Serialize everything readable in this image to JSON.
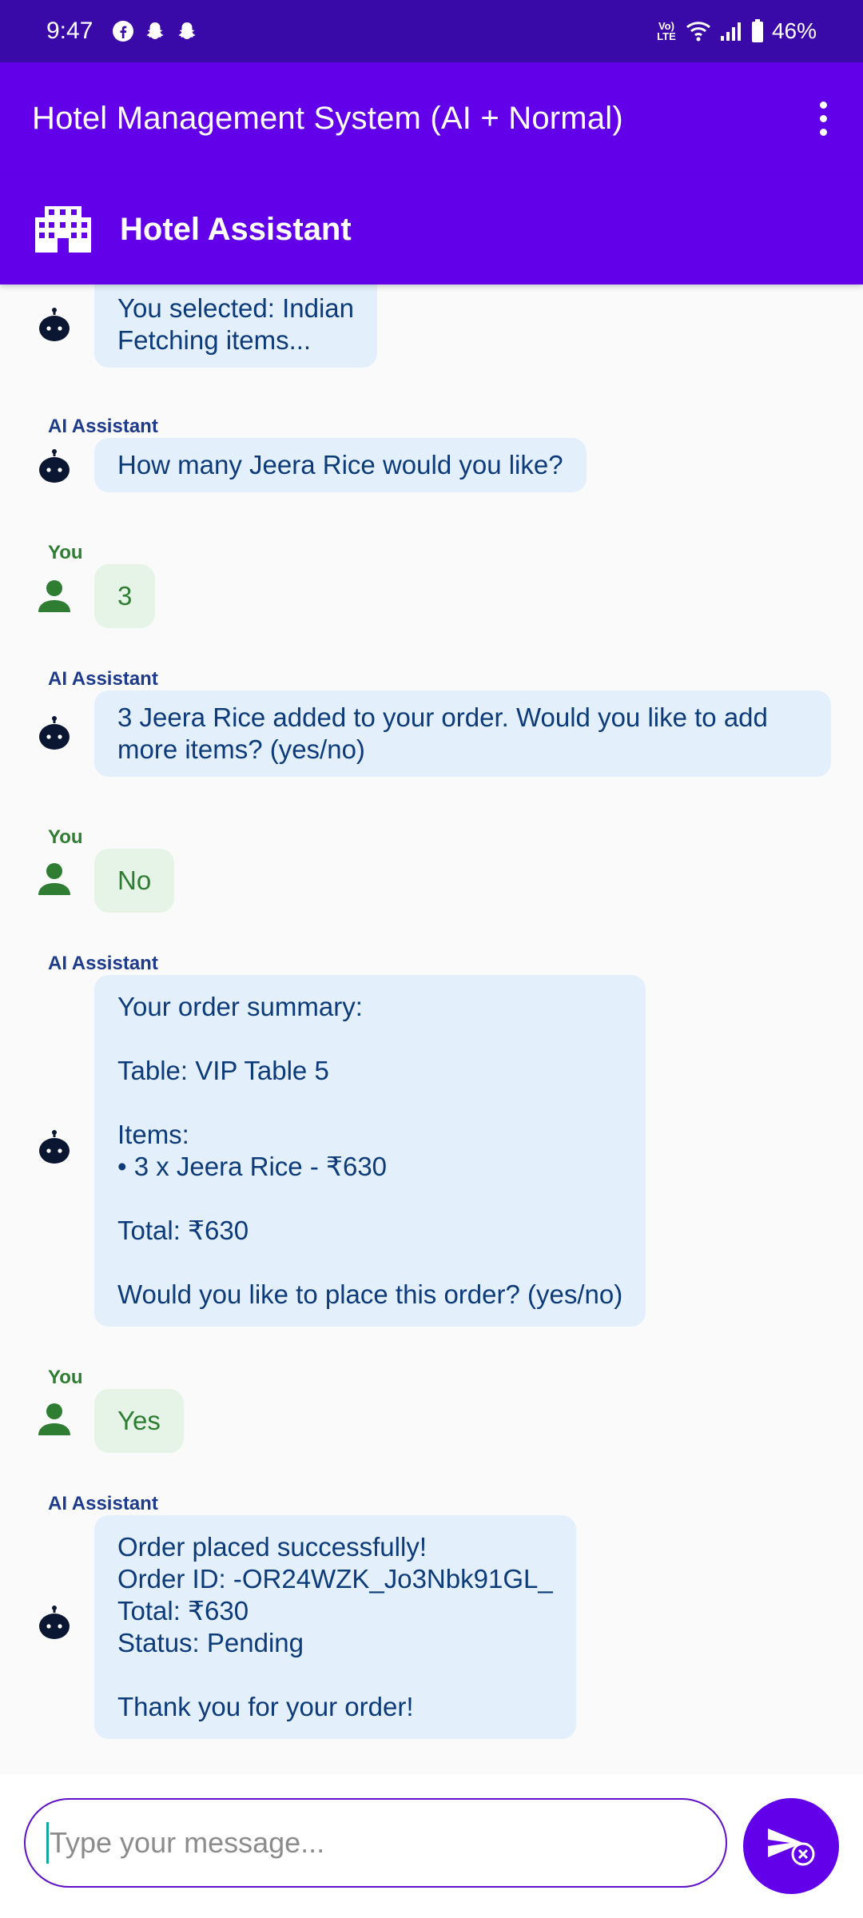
{
  "status_bar": {
    "time": "9:47",
    "network_label": "Vo) LTE",
    "battery": "46%"
  },
  "app_bar": {
    "title": "Hotel Management System (AI + Normal)"
  },
  "assistant_bar": {
    "title": "Hotel Assistant"
  },
  "chat": {
    "messages": [
      {
        "sender": "",
        "role": "ai",
        "text": "You selected: Indian\nFetching items..."
      },
      {
        "sender": "AI Assistant",
        "role": "ai",
        "text": "How many Jeera Rice would you like?"
      },
      {
        "sender": "You",
        "role": "user",
        "text": "3"
      },
      {
        "sender": "AI Assistant",
        "role": "ai",
        "text": "3 Jeera Rice added to your order. Would you like to add\nmore items? (yes/no)"
      },
      {
        "sender": "You",
        "role": "user",
        "text": "No"
      },
      {
        "sender": "AI Assistant",
        "role": "ai",
        "text": "Your order summary:\n\nTable: VIP Table 5\n\nItems:\n• 3 x Jeera Rice - ₹630\n\nTotal: ₹630\n\nWould you like to place this order? (yes/no)"
      },
      {
        "sender": "You",
        "role": "user",
        "text": "Yes"
      },
      {
        "sender": "AI Assistant",
        "role": "ai",
        "text": "Order placed successfully!\nOrder ID: -OR24WZK_Jo3Nbk91GL_\nTotal: ₹630\nStatus: Pending\n\nThank you for your order!"
      }
    ]
  },
  "input": {
    "placeholder": "Type your message...",
    "value": ""
  },
  "icons": {
    "hotel": "hotel-building-icon",
    "ai_avatar": "robot-icon",
    "user_avatar": "person-icon",
    "send": "send-icon"
  },
  "colors": {
    "status_bar": "#3a0aa8",
    "primary": "#6200ea",
    "ai_bubble": "#e3f0fb",
    "ai_text": "#0d3b7a",
    "user_bubble": "#e6f4e7",
    "user_text": "#2e7d32"
  }
}
